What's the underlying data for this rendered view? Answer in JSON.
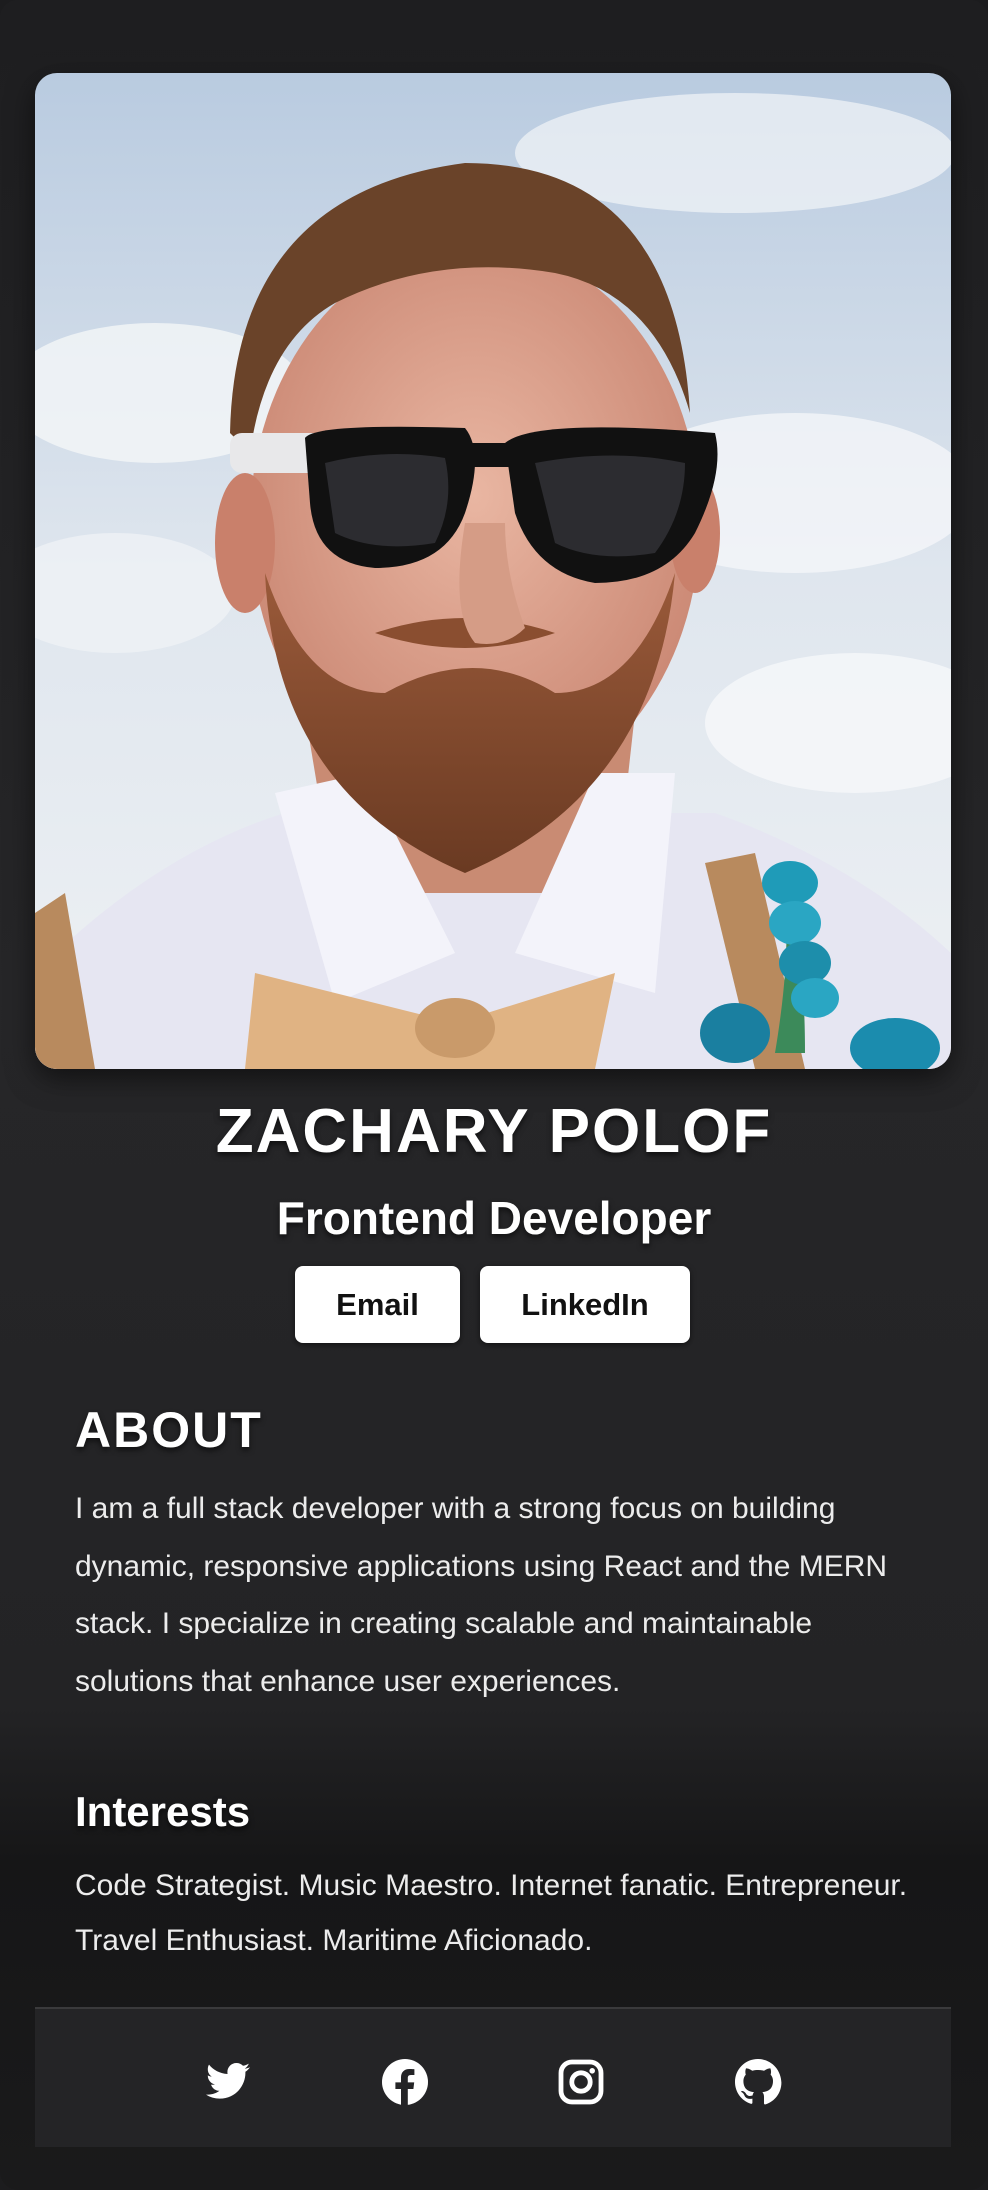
{
  "profile": {
    "name": "ZACHARY POLOF",
    "role": "Frontend Developer",
    "photo_alt": "Profile photo"
  },
  "actions": {
    "email_label": "Email",
    "linkedin_label": "LinkedIn"
  },
  "about": {
    "title": "ABOUT",
    "text": "I am a full stack developer with a strong focus on building dynamic, responsive applications using React and the MERN stack. I specialize in creating scalable and maintainable solutions that enhance user experiences."
  },
  "interests": {
    "title": "Interests",
    "text": "Code Strategist. Music Maestro. Internet fanatic. Entrepreneur. Travel Enthusiast. Maritime Aficionado."
  },
  "footer": {
    "icons": [
      "twitter-icon",
      "facebook-icon",
      "instagram-icon",
      "github-icon"
    ]
  },
  "colors": {
    "background": "#1c1c1e",
    "button_bg": "#ffffff",
    "footer_bg": "#242426"
  }
}
